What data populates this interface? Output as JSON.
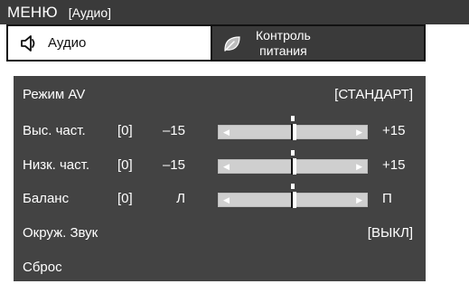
{
  "title": {
    "main": "МЕНЮ",
    "sub": "[Аудио]"
  },
  "tabs": [
    {
      "label": "Аудио",
      "icon": "audio-speaker-icon",
      "active": true
    },
    {
      "label_line1": "Контроль",
      "label_line2": "питания",
      "icon": "leaf-icon",
      "active": false
    }
  ],
  "menu": {
    "av_mode": {
      "label": "Режим AV",
      "value": "[СТАНДАРТ]"
    },
    "treble": {
      "label": "Выс. част.",
      "value": "[0]",
      "min": "–15",
      "max": "+15",
      "level": 0.5
    },
    "bass": {
      "label": "Низк. част.",
      "value": "[0]",
      "min": "–15",
      "max": "+15",
      "level": 0.5
    },
    "balance": {
      "label": "Баланс",
      "value": "[0]",
      "min": "Л",
      "max": "П",
      "level": 0.5
    },
    "surround": {
      "label": "Окруж. Звук",
      "value": "[ВЫКЛ]"
    },
    "reset": {
      "label": "Сброс"
    }
  },
  "colors": {
    "bar": "#3a3a3a",
    "panel": "#434343",
    "slider": "#cfcfcf"
  }
}
